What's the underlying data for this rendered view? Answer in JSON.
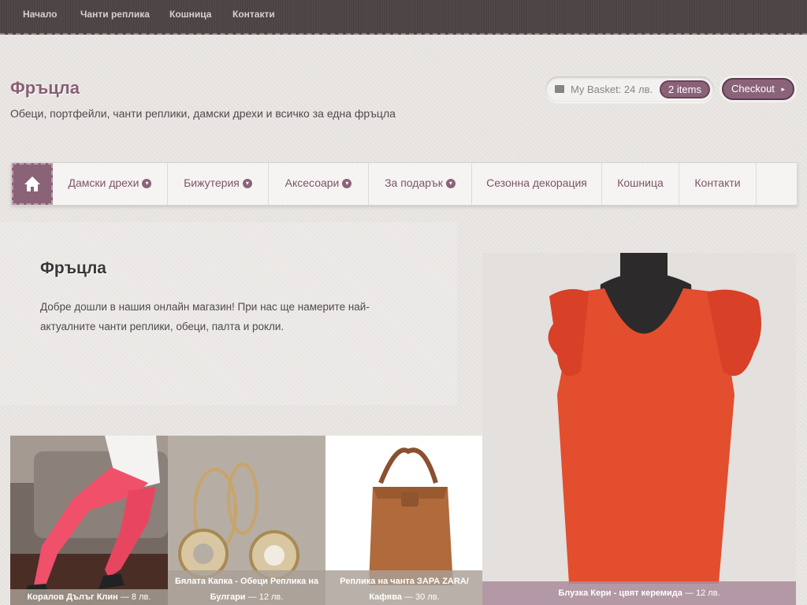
{
  "topbar": {
    "links": [
      "Начало",
      "Чанти реплика",
      "Кошница",
      "Контакти"
    ]
  },
  "header": {
    "title": "Фръцла",
    "tagline": "Обеци, портфейли, чанти реплики, дамски дрехи и всичко за една фръцла"
  },
  "basket": {
    "label": "My Basket: 24 лв.",
    "items": "2 items",
    "checkout": "Checkout",
    "checkout_arrow": "▸"
  },
  "nav": {
    "items": [
      "Дамски дрехи",
      "Бижутерия",
      "Аксесоари",
      "За подарък",
      "Сезонна декорация",
      "Кошница",
      "Контакти"
    ]
  },
  "welcome": {
    "title": "Фръцла",
    "text": "Добре дошли в нашия онлайн магазин! При нас ще намерите най-актуалните чанти реплики, обеци, палта и рокли."
  },
  "products": [
    {
      "name": "Коралов Дълъг Клин",
      "price": "— 8 лв."
    },
    {
      "name": "Бялата Капка - Обеци Реплика на Булгари",
      "price": "— 12 лв."
    },
    {
      "name": "Реплика на чанта ЗАРА ZARA/ Кафява",
      "price": "— 30 лв."
    },
    {
      "name": "Блузка Кери - цвят керемида",
      "price": "— 12 лв."
    }
  ],
  "colors": {
    "accent": "#8a6379",
    "topbar": "#4c4344"
  }
}
